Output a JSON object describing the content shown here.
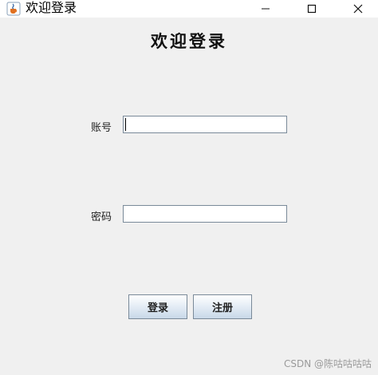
{
  "window": {
    "title": "欢迎登录",
    "icon": "java-cup-icon",
    "controls": [
      "minimize-icon",
      "maximize-icon",
      "close-icon"
    ]
  },
  "form": {
    "heading": "欢迎登录",
    "account_label": "账号",
    "account_value": "",
    "password_label": "密码",
    "password_value": "",
    "login_button": "登录",
    "register_button": "注册"
  },
  "watermark": "CSDN @陈咕咕咕咕"
}
